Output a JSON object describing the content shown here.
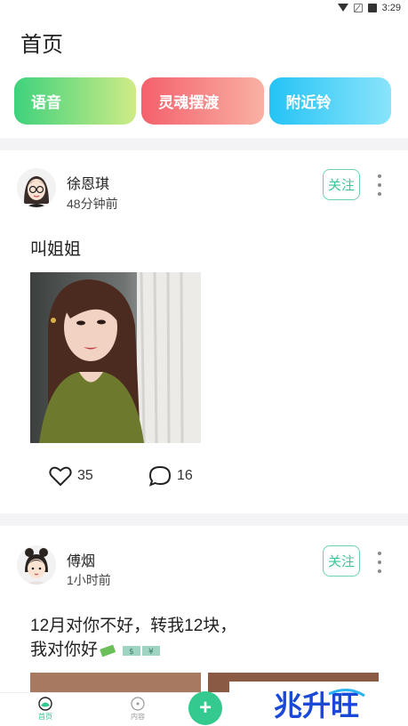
{
  "status_bar": {
    "time": "3:29"
  },
  "page_title": "首页",
  "quick_actions": [
    {
      "label": "语音"
    },
    {
      "label": "灵魂摆渡"
    },
    {
      "label": "附近铃"
    }
  ],
  "posts": [
    {
      "username": "徐恩琪",
      "time": "48分钟前",
      "follow_label": "关注",
      "text": "叫姐姐",
      "likes": "35",
      "comments": "16"
    },
    {
      "username": "傅烟",
      "time": "1小时前",
      "follow_label": "关注",
      "text_line1": "12月对你不好，转我12块，",
      "text_line2": "我对你好"
    }
  ],
  "bottom_nav": {
    "tab_home": "首页",
    "tab_content": "内容",
    "add_label": "+"
  },
  "watermark": "兆升旺",
  "colors": {
    "accent": "#34c98e",
    "follow": "#3cc79b"
  }
}
